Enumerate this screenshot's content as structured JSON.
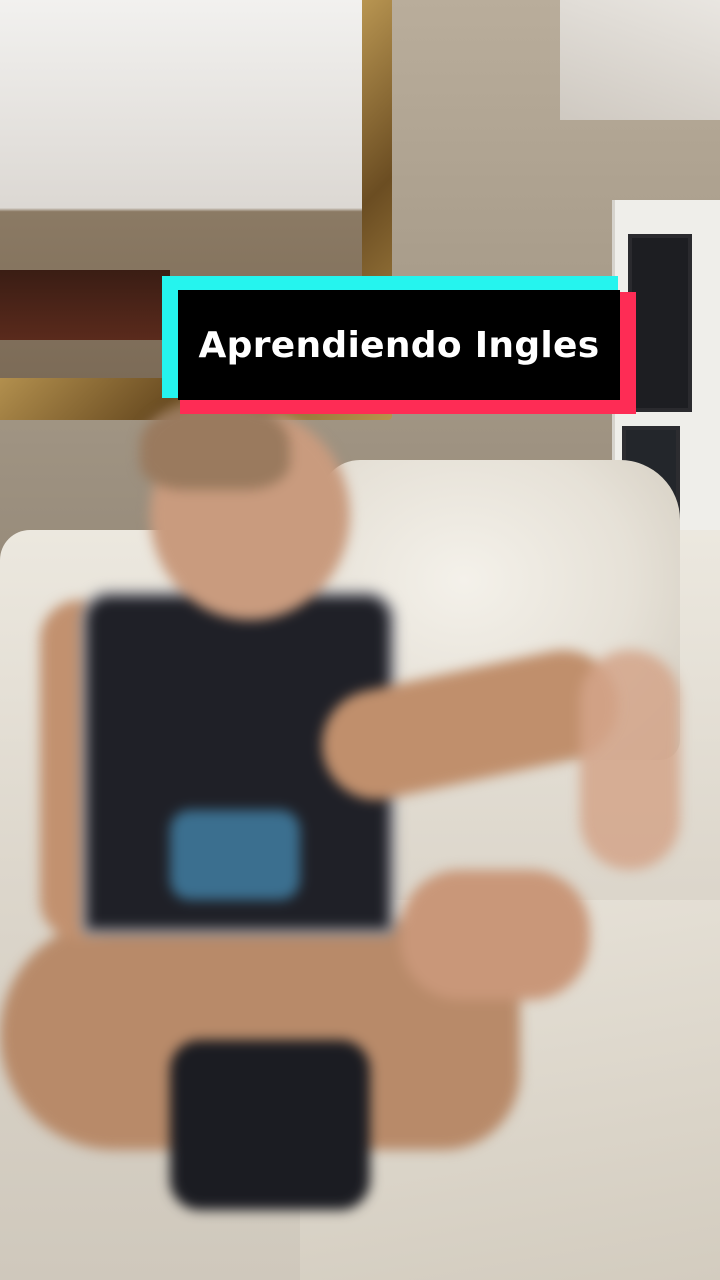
{
  "caption": {
    "text": "Aprendiendo Ingles",
    "colors": {
      "box": "#000000",
      "text": "#ffffff",
      "accent_cyan": "#25f4ee",
      "accent_red": "#fe2c55"
    }
  },
  "scene": {
    "subject": "person",
    "objects": [
      "mirror",
      "sofa",
      "blanket",
      "cabinet",
      "picture"
    ]
  }
}
